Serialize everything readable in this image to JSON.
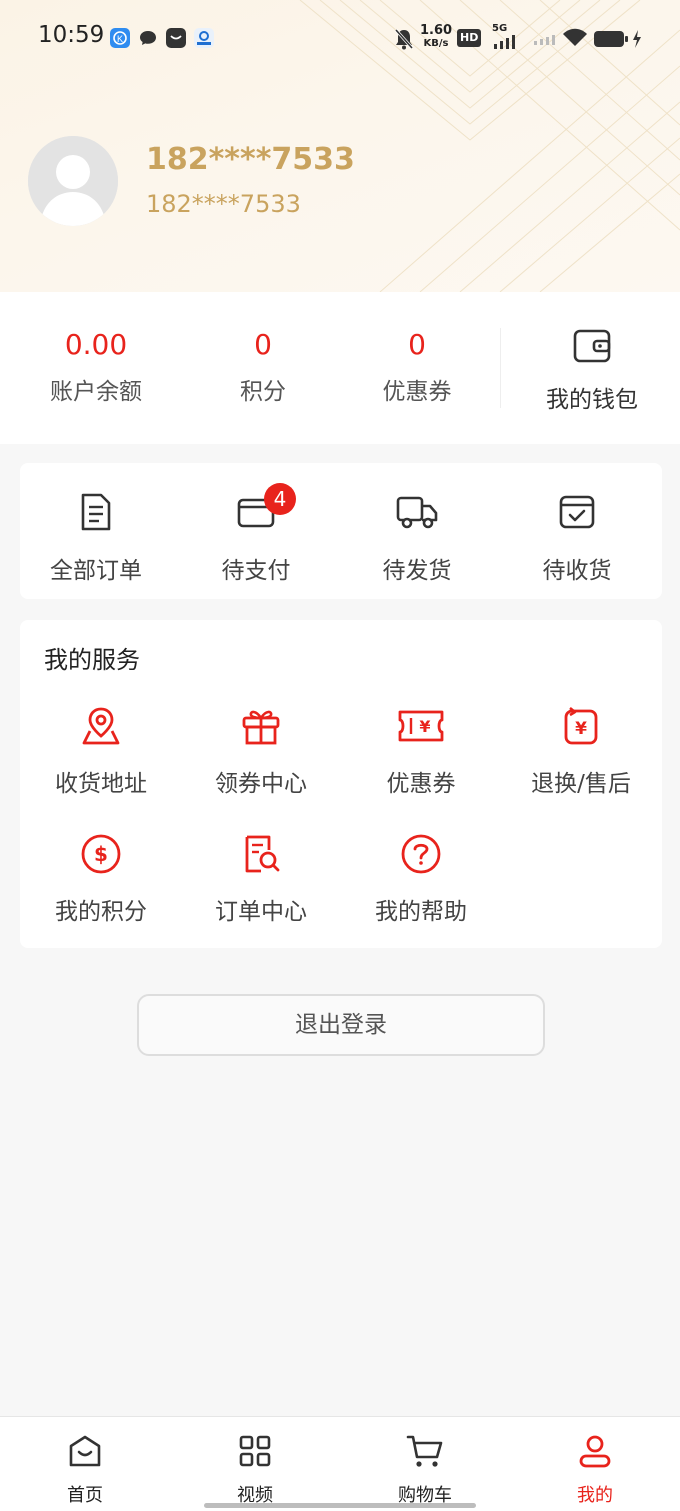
{
  "status_bar": {
    "time": "10:59",
    "speed_value": "1.60",
    "speed_unit": "KB/s",
    "hd_label": "HD",
    "network": "5G",
    "icons": [
      "app-k-icon",
      "message-icon",
      "mail-icon",
      "app-c-icon",
      "mute-bell-icon",
      "signal-icon",
      "wifi-icon",
      "battery-icon",
      "charging-icon"
    ]
  },
  "profile": {
    "name": "182****7533",
    "phone": "182****7533"
  },
  "stats": {
    "balance": {
      "value": "0.00",
      "label": "账户余额"
    },
    "points": {
      "value": "0",
      "label": "积分"
    },
    "coupons": {
      "value": "0",
      "label": "优惠券"
    },
    "wallet_label": "我的钱包"
  },
  "orders": {
    "items": [
      {
        "label": "全部订单",
        "icon": "document-icon"
      },
      {
        "label": "待支付",
        "icon": "wallet-card-icon",
        "badge": "4"
      },
      {
        "label": "待发货",
        "icon": "truck-icon"
      },
      {
        "label": "待收货",
        "icon": "box-check-icon"
      }
    ]
  },
  "services": {
    "title": "我的服务",
    "items": [
      {
        "label": "收货地址",
        "icon": "map-pin-icon"
      },
      {
        "label": "领券中心",
        "icon": "gift-icon"
      },
      {
        "label": "优惠券",
        "icon": "ticket-icon"
      },
      {
        "label": "退换/售后",
        "icon": "refund-icon"
      },
      {
        "label": "我的积分",
        "icon": "dollar-circle-icon"
      },
      {
        "label": "订单中心",
        "icon": "order-search-icon"
      },
      {
        "label": "我的帮助",
        "icon": "help-circle-icon"
      }
    ]
  },
  "logout_label": "退出登录",
  "tabbar": {
    "tabs": [
      {
        "label": "首页",
        "icon": "home-icon"
      },
      {
        "label": "视频",
        "icon": "grid-icon"
      },
      {
        "label": "购物车",
        "icon": "cart-icon"
      },
      {
        "label": "我的",
        "icon": "user-icon",
        "active": true
      }
    ]
  },
  "colors": {
    "accent": "#e8231c",
    "gold": "#c9a35e",
    "header_bg": "#fbf3e6"
  }
}
